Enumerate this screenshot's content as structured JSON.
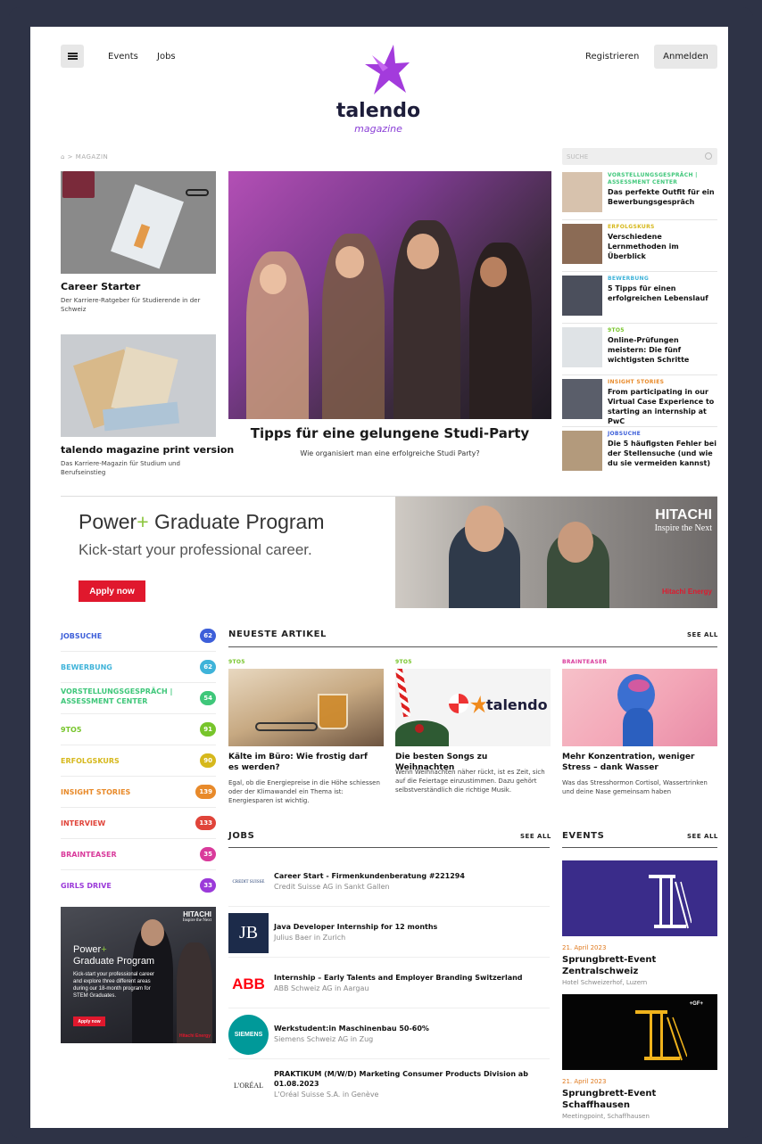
{
  "header": {
    "nav": [
      "Events",
      "Jobs"
    ],
    "register": "Registrieren",
    "login": "Anmelden",
    "logo_text": "talendo",
    "logo_sub": "magazine"
  },
  "breadcrumb": "MAGAZIN",
  "search": {
    "placeholder": "SUCHE"
  },
  "left_cards": [
    {
      "title": "Career Starter",
      "subtitle": "Der Karriere-Ratgeber für Studierende in der Schweiz"
    },
    {
      "title": "talendo magazine print version",
      "subtitle": "Das Karriere-Magazin für Studium und Berufseinstieg"
    }
  ],
  "hero": {
    "title": "Tipps für eine gelungene Studi-Party",
    "subtitle": "Wie organisiert man eine erfolgreiche Studi Party?"
  },
  "sidebar_articles": [
    {
      "category": "VORSTELLUNGSGESPRÄCH | ASSESSMENT CENTER",
      "title": "Das perfekte Outfit für ein Bewerbungsgespräch",
      "color": "#3fc77a"
    },
    {
      "category": "ERFOLGSKURS",
      "title": "Verschiedene Lernmethoden im Überblick",
      "color": "#d6b81c"
    },
    {
      "category": "BEWERBUNG",
      "title": "5 Tipps für einen erfolgreichen Lebenslauf",
      "color": "#3fb3d9"
    },
    {
      "category": "9TO5",
      "title": "Online-Prüfungen meistern: Die fünf wichtigsten Schritte",
      "color": "#77c52b"
    },
    {
      "category": "INSIGHT STORIES",
      "title": "From participating in our Virtual Case Experience to starting an internship at PwC",
      "color": "#e88a2a"
    },
    {
      "category": "JOBSUCHE",
      "title": "Die 5 häufigsten Fehler bei der Stellensuche (und wie du sie vermeiden kannst)",
      "color": "#3d5fd9"
    }
  ],
  "banner": {
    "title_a": "Power",
    "title_plus": "+",
    "title_b": " Graduate Program",
    "subtitle": "Kick-start your professional career.",
    "cta": "Apply now",
    "brand": "HITACHI",
    "tagline": "Inspire the Next",
    "brand2": "Hitachi Energy"
  },
  "categories": [
    {
      "label": "JOBSUCHE",
      "count": "62",
      "color": "#3d5fd9"
    },
    {
      "label": "BEWERBUNG",
      "count": "62",
      "color": "#3fb3d9"
    },
    {
      "label": "VORSTELLUNGSGESPRÄCH | ASSESSMENT CENTER",
      "count": "54",
      "color": "#3fc77a"
    },
    {
      "label": "9TO5",
      "count": "91",
      "color": "#77c52b"
    },
    {
      "label": "ERFOLGSKURS",
      "count": "90",
      "color": "#d6b81c"
    },
    {
      "label": "INSIGHT STORIES",
      "count": "139",
      "color": "#e88a2a"
    },
    {
      "label": "INTERVIEW",
      "count": "133",
      "color": "#e0443a"
    },
    {
      "label": "BRAINTEASER",
      "count": "35",
      "color": "#d93a9b"
    },
    {
      "label": "GIRLS DRIVE",
      "count": "33",
      "color": "#9b3ad9"
    }
  ],
  "side_ad": {
    "brand": "HITACHI",
    "tagline": "Inspire the Next",
    "title_a": "Power",
    "title_plus": "+",
    "title_b": "Graduate Program",
    "text": "Kick-start your professional career and explore three different areas during our 18-month program for STEM Graduates.",
    "cta": "Apply now",
    "brand2": "Hitachi Energy"
  },
  "latest": {
    "heading": "NEUESTE ARTIKEL",
    "see_all": "SEE ALL",
    "articles": [
      {
        "category": "9TO5",
        "title": "Kälte im Büro: Wie frostig darf es werden?",
        "text": "Egal, ob die Energiepreise in die Höhe schiessen oder der Klimawandel ein Thema ist: Energiesparen ist wichtig.",
        "color": "#77c52b"
      },
      {
        "category": "9TO5",
        "title": "Die besten Songs zu Weihnachten",
        "text": "Wenn Weihnachten näher rückt, ist es Zeit, sich auf die Feiertage einzustimmen. Dazu gehört selbstverständlich die richtige Musik.",
        "color": "#77c52b",
        "brand": "talendo"
      },
      {
        "category": "BRAINTEASER",
        "title": "Mehr Konzentration, weniger Stress – dank Wasser",
        "text": "Was das Stresshormon Cortisol, Wassertrinken und deine Nase gemeinsam haben",
        "color": "#d93a9b"
      }
    ]
  },
  "jobs": {
    "heading": "JOBS",
    "see_all": "SEE ALL",
    "items": [
      {
        "logo": "CREDIT SUISSE",
        "title": "Career Start - Firmenkundenberatung #221294",
        "company": "Credit Suisse AG in Sankt Gallen"
      },
      {
        "logo": "JB",
        "title": "Java Developer Internship for 12 months",
        "company": "Julius Baer in Zurich"
      },
      {
        "logo": "ABB",
        "title": "Internship – Early Talents and Employer Branding Switzerland",
        "company": "ABB Schweiz AG in Aargau"
      },
      {
        "logo": "SIEMENS",
        "title": "Werkstudent:in Maschinenbau 50-60%",
        "company": "Siemens Schweiz AG in Zug"
      },
      {
        "logo": "L'ORÉAL",
        "title": "PRAKTIKUM (M/W/D) Marketing Consumer Products Division ab 01.08.2023",
        "company": "L'Oréal Suisse S.A. in Genève"
      }
    ]
  },
  "events": {
    "heading": "EVENTS",
    "see_all": "SEE ALL",
    "items": [
      {
        "date": "21. April 2023",
        "title": "Sprungbrett-Event Zentralschweiz",
        "location": "Hotel Schweizerhof, Luzern"
      },
      {
        "date": "21. April 2023",
        "title": "Sprungbrett-Event Schaffhausen",
        "location": "Meetingpoint, Schaffhausen",
        "badge": "+GF+"
      }
    ]
  }
}
